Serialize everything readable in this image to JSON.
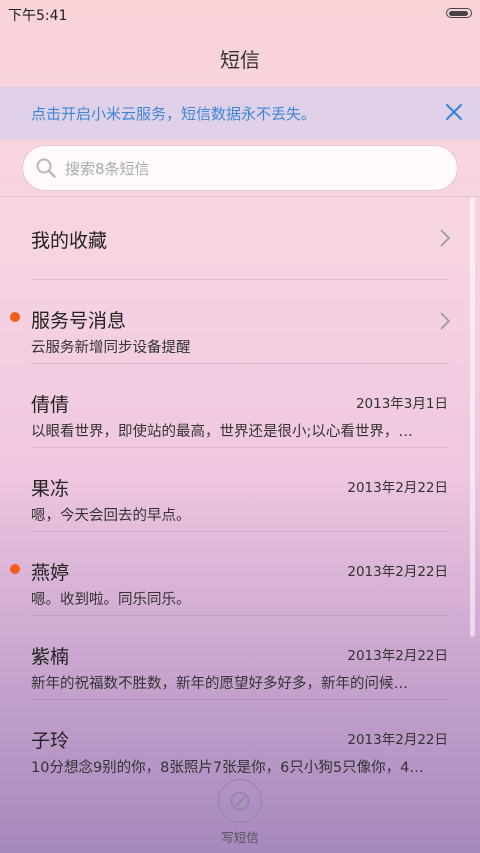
{
  "status": {
    "time": "下午5:41"
  },
  "title": "短信",
  "banner": {
    "text": "点击开启小米云服务，短信数据永不丢失。"
  },
  "search": {
    "placeholder": "搜索8条短信"
  },
  "threads": [
    {
      "name": "我的收藏",
      "preview": "",
      "date": "",
      "unread": false,
      "chevron": true
    },
    {
      "name": "服务号消息",
      "preview": "云服务新增同步设备提醒",
      "date": "",
      "unread": true,
      "chevron": true
    },
    {
      "name": "倩倩",
      "preview": "以眼看世界，即使站的最高，世界还是很小;以心看世界，…",
      "date": "2013年3月1日",
      "unread": false,
      "chevron": false
    },
    {
      "name": "果冻",
      "preview": "嗯，今天会回去的早点。",
      "date": "2013年2月22日",
      "unread": false,
      "chevron": false
    },
    {
      "name": "燕婷",
      "preview": "嗯。收到啦。同乐同乐。",
      "date": "2013年2月22日",
      "unread": true,
      "chevron": false
    },
    {
      "name": "紫楠",
      "preview": "新年的祝福数不胜数，新年的愿望好多好多，新年的问候…",
      "date": "2013年2月22日",
      "unread": false,
      "chevron": false
    },
    {
      "name": "子玲",
      "preview": "10分想念9别的你，8张照片7张是你，6只小狗5只像你，4…",
      "date": "2013年2月22日",
      "unread": false,
      "chevron": false
    }
  ],
  "compose": {
    "label": "写短信"
  },
  "colors": {
    "accent": "#3d86d6",
    "unread": "#f35c1a"
  }
}
